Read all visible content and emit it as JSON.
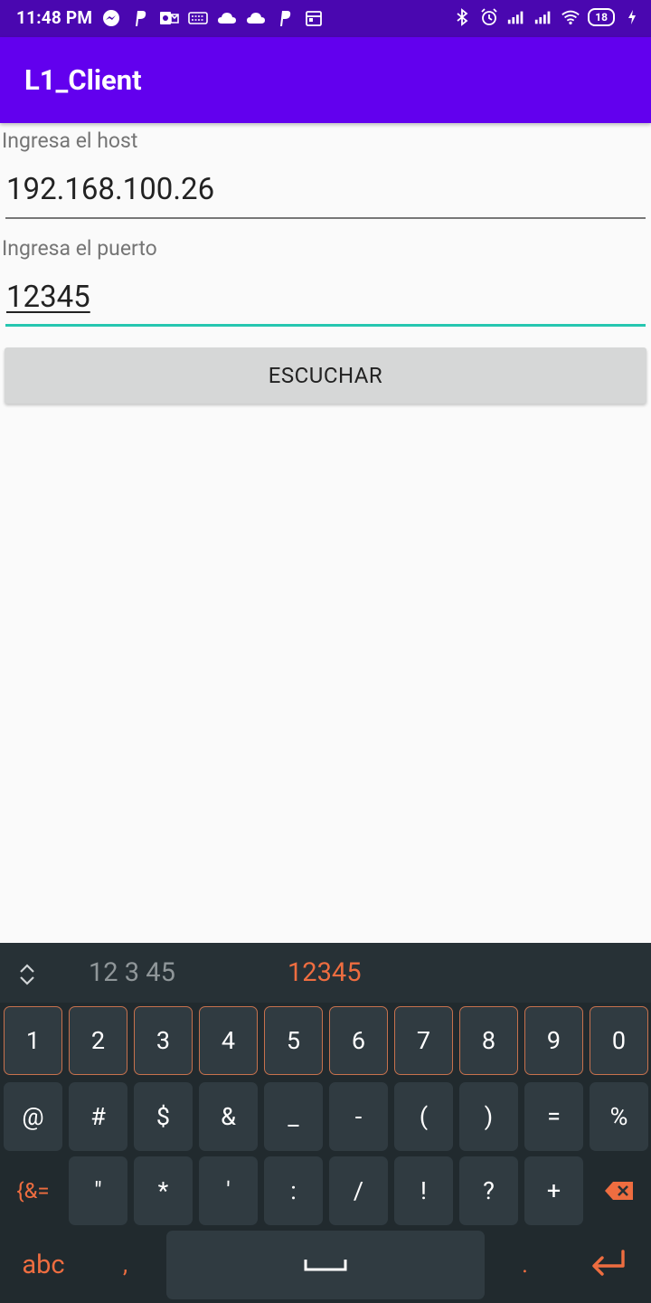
{
  "status_bar": {
    "time": "11:48 PM",
    "battery": "18"
  },
  "app_bar": {
    "title": "L1_Client"
  },
  "form": {
    "host_label": "Ingresa el host",
    "host_value": "192.168.100.26",
    "port_label": "Ingresa el puerto",
    "port_value": "12345",
    "listen_button": "ESCUCHAR"
  },
  "keyboard": {
    "suggestions": [
      "12 3 45",
      "12345"
    ],
    "row1": [
      "1",
      "2",
      "3",
      "4",
      "5",
      "6",
      "7",
      "8",
      "9",
      "0"
    ],
    "row2": [
      "@",
      "#",
      "$",
      "&",
      "_",
      "-",
      "(",
      ")",
      "=",
      "%"
    ],
    "row3": [
      "{&=",
      "\"",
      "*",
      "'",
      ":",
      "/",
      "!",
      "?",
      "+"
    ],
    "bottom": {
      "abc": "abc",
      "comma": ",",
      "period": "."
    }
  },
  "colors": {
    "status_bar": "#4a07b0",
    "app_bar": "#6200ee",
    "accent": "#26c6b0",
    "keyboard_accent": "#ee6d40"
  }
}
